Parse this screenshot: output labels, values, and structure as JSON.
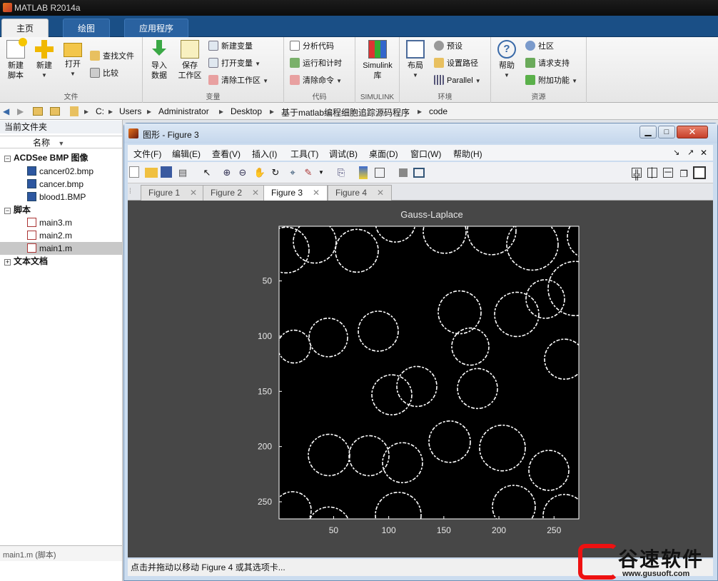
{
  "app": {
    "title": "MATLAB R2014a"
  },
  "ribbon_tabs": [
    "主页",
    "绘图",
    "应用程序"
  ],
  "ribbon": {
    "file": {
      "new_script": "新建\n脚本",
      "new": "新建",
      "open": "打开",
      "find_files": "查找文件",
      "compare": "比较",
      "group": "文件"
    },
    "variable": {
      "import": "导入\n数据",
      "save_ws": "保存\n工作区",
      "new_var": "新建变量",
      "open_var": "打开变量",
      "clear_ws": "清除工作区",
      "group": "变量"
    },
    "code": {
      "analyze": "分析代码",
      "run_time": "运行和计时",
      "clear_cmd": "清除命令",
      "group": "代码"
    },
    "simulink": {
      "lib": "Simulink\n库",
      "group": "SIMULINK"
    },
    "env": {
      "layout": "布局",
      "prefs": "预设",
      "setpath": "设置路径",
      "parallel": "Parallel",
      "group": "环境"
    },
    "resources": {
      "help": "帮助",
      "community": "社区",
      "support": "请求支持",
      "addons": "附加功能",
      "group": "资源"
    }
  },
  "path": [
    "C:",
    "Users",
    "Administrator",
    "Desktop",
    "基于matlab编程细胞追踪源码程序",
    "code"
  ],
  "left_panel": {
    "header": "当前文件夹",
    "col_name": "名称",
    "groups": [
      {
        "label": "ACDSee BMP 图像",
        "items": [
          "cancer02.bmp",
          "cancer.bmp",
          "blood1.BMP"
        ]
      },
      {
        "label": "脚本",
        "items": [
          "main3.m",
          "main2.m",
          "main1.m"
        ]
      },
      {
        "label": "文本文档",
        "items": []
      }
    ],
    "selected": "main1.m",
    "footer": "main1.m",
    "footer_type": "(脚本)"
  },
  "figure": {
    "title": "图形 - Figure 3",
    "menu": [
      "文件(F)",
      "编辑(E)",
      "查看(V)",
      "插入(I)",
      "工具(T)",
      "调试(B)",
      "桌面(D)",
      "窗口(W)",
      "帮助(H)"
    ],
    "tabs": [
      "Figure 1",
      "Figure 2",
      "Figure 3",
      "Figure 4"
    ],
    "active_tab": "Figure 3",
    "status": "点击并拖动以移动 Figure 4 或其选项卡..."
  },
  "chart_data": {
    "type": "image",
    "title": "Gauss-Laplace",
    "xticks": [
      50,
      100,
      150,
      200,
      250
    ],
    "yticks": [
      50,
      100,
      150,
      200,
      250
    ],
    "xlim": [
      0.5,
      272.5
    ],
    "ylim": [
      0.5,
      265.5
    ],
    "colors": {
      "bg": "#000000",
      "edge": "#ffffff",
      "figure_bg": "#474747"
    }
  },
  "watermark": {
    "text": "谷速软件",
    "url": "www.gusuoft.com"
  }
}
